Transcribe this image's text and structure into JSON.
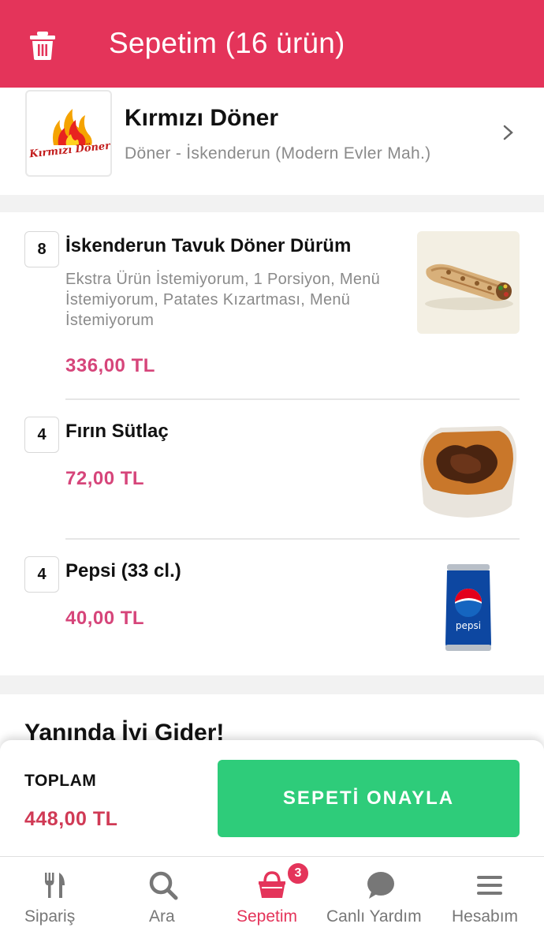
{
  "header": {
    "title": "Sepetim (16 ürün)",
    "background": "#e4345a",
    "left_icon": "trash-icon"
  },
  "restaurant": {
    "name": "Kırmızı Döner",
    "subtitle": "Döner - İskenderun (Modern Evler Mah.)",
    "logo_text": "Kırmızı Döner",
    "logo_icon": "flame-logo-icon",
    "chevron_icon": "chevron-right-icon"
  },
  "items": [
    {
      "qty": "8",
      "name": "İskenderun Tavuk Döner Dürüm",
      "desc": "Ekstra Ürün İstemiyorum, 1 Porsiyon, Menü İstemiyorum, Patates Kızartması, Menü İstemiyorum",
      "price": "336,00 TL",
      "image_icon": "durum-wrap-image"
    },
    {
      "qty": "4",
      "name": "Fırın Sütlaç",
      "desc": "",
      "price": "72,00 TL",
      "image_icon": "sutlac-dessert-image"
    },
    {
      "qty": "4",
      "name": "Pepsi (33 cl.)",
      "desc": "",
      "price": "40,00 TL",
      "image_icon": "pepsi-can-image",
      "can_text": "pepsi"
    }
  ],
  "suggestion": {
    "title": "Yanında İyi Gider!"
  },
  "footer": {
    "total_label": "TOPLAM",
    "total_value": "448,00 TL",
    "confirm_label": "SEPETİ ONAYLA",
    "confirm_color": "#2ecc7a"
  },
  "tabbar": {
    "tabs": [
      {
        "label": "Sipariş",
        "icon": "fork-knife-icon",
        "active": false
      },
      {
        "label": "Ara",
        "icon": "search-icon",
        "active": false
      },
      {
        "label": "Sepetim",
        "icon": "basket-icon",
        "active": true,
        "badge": "3"
      },
      {
        "label": "Canlı Yardım",
        "icon": "chat-bubble-icon",
        "active": false
      },
      {
        "label": "Hesabım",
        "icon": "hamburger-menu-icon",
        "active": false
      }
    ]
  },
  "colors": {
    "brand": "#e4345a",
    "price": "#d6457a",
    "total": "#d03a55",
    "muted": "#8a8a8a"
  }
}
